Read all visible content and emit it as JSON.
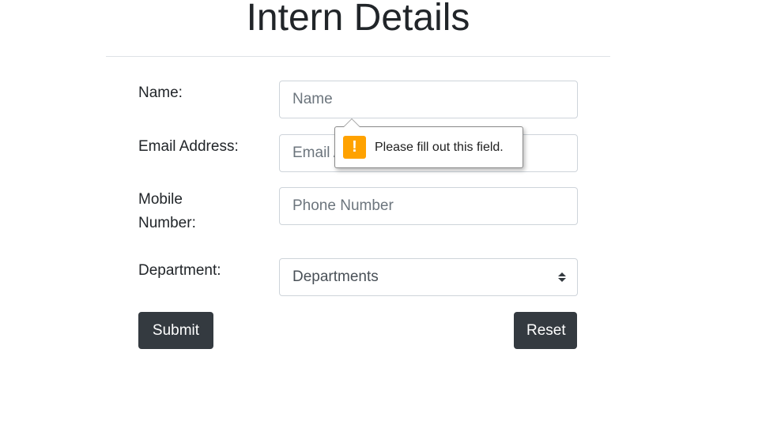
{
  "page": {
    "title": "Intern Details"
  },
  "form": {
    "name_label": "Name:",
    "name_placeholder": "Name",
    "email_label": "Email Address:",
    "email_placeholder": "Email Address",
    "mobile_label_line1": "Mobile",
    "mobile_label_line2": "Number:",
    "mobile_placeholder": "Phone Number",
    "department_label": "Department:",
    "department_selected": "Departments",
    "submit_label": "Submit",
    "reset_label": "Reset"
  },
  "validation": {
    "message": "Please fill out this field.",
    "icon": "warning-icon",
    "icon_glyph": "!",
    "icon_color": "#ffa200"
  },
  "colors": {
    "button_bg": "#343a40",
    "button_text": "#ffffff",
    "input_border": "#ced4da"
  }
}
